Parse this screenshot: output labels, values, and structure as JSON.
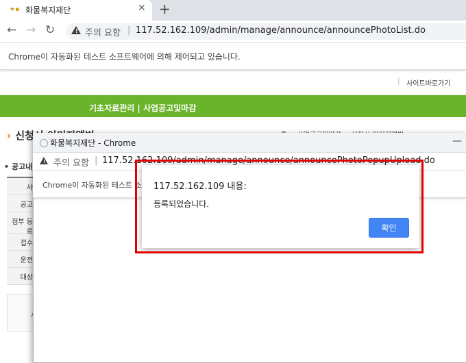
{
  "browser": {
    "tab_title": "화물복지재단",
    "tab_favicon_text": "★▪",
    "tab_close": "✕",
    "new_tab": "+",
    "back": "←",
    "forward": "→",
    "reload": "↻",
    "security_label": "주의 요함",
    "url": "117.52.162.109/admin/manage/announce/announcePhotoList.do",
    "automation_notice": "Chrome이 자동화된 테스트 소프트웨어에 의해 제어되고 있습니다."
  },
  "page": {
    "site_nav": "사이트바로가기",
    "main_nav": "기초자료관리 | 사업공고및마감",
    "heading": "신청서 이미지앨범",
    "breadcrumb": "⌂ 홈 > 사업공고및마감 > 신청서 이미지앨범",
    "section_label": "• 공고내",
    "table_rows": [
      "사",
      "공고",
      "첨부 등록",
      "접수",
      "운전",
      "대상"
    ],
    "lower_label": "서"
  },
  "popup": {
    "title": "화물복지재단 - Chrome",
    "minimize": "—",
    "security_label": "주의 요함",
    "url": "117.52.162.109/admin/manage/announce/announcePhotoPopupUpload.do",
    "automation_notice": "Chrome이 자동화된 테스트 소프트웨어에 의해 제어되고 있습니다."
  },
  "alert": {
    "title": "117.52.162.109 내용:",
    "message": "등록되었습니다.",
    "ok_label": "확인"
  },
  "colors": {
    "green_bar": "#69b42a",
    "highlight": "#e00000",
    "ok_button": "#4285f4"
  }
}
